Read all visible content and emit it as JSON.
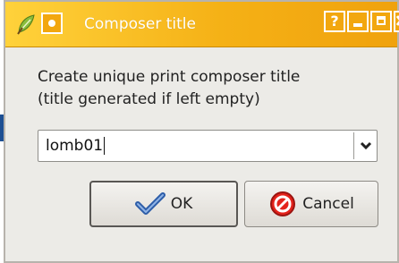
{
  "window": {
    "title": "Composer title",
    "buttons": {
      "help": "?"
    }
  },
  "dialog": {
    "prompt": "Create unique print composer title\n(title generated if left empty)",
    "title_field": {
      "value": "lomb01"
    },
    "ok_label": "OK",
    "cancel_label": "Cancel"
  },
  "colors": {
    "titlebar": "#f5b116",
    "background": "#ecebe7",
    "accent_blue": "#1d4f93"
  },
  "icons": [
    "qgis-leaf-icon",
    "window-menu-icon",
    "help-icon",
    "minimize-icon",
    "maximize-icon",
    "close-icon",
    "chevron-down-icon",
    "checkmark-icon",
    "cancel-icon"
  ]
}
